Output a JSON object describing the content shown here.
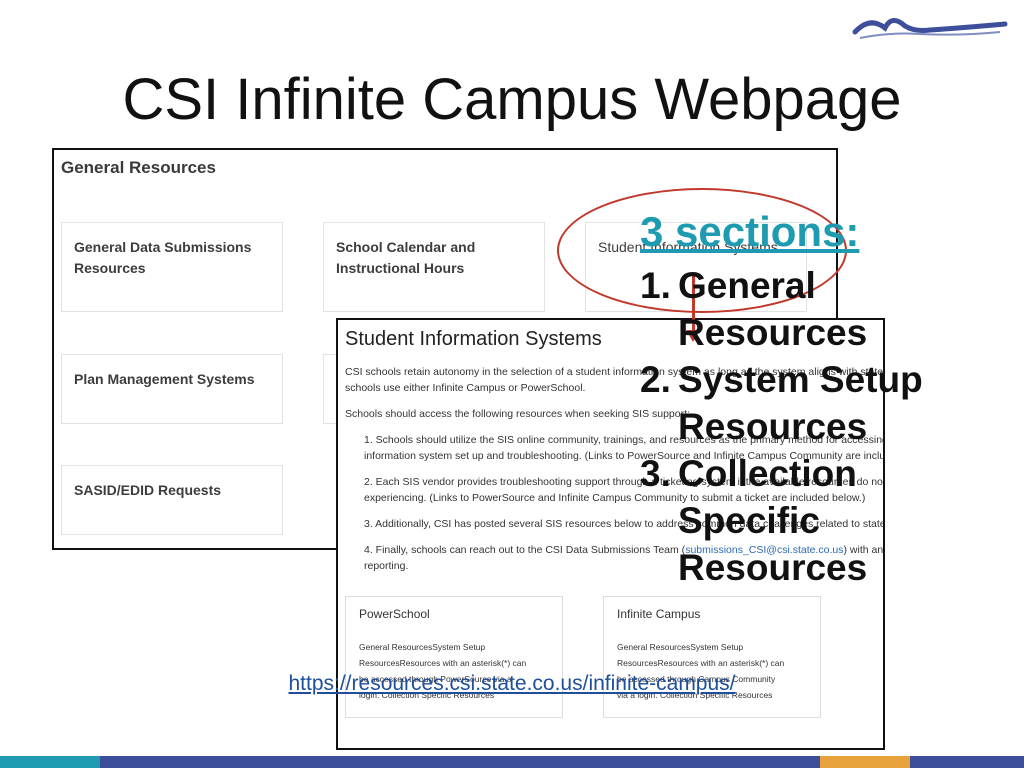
{
  "slide": {
    "title": "CSI Infinite Campus Webpage",
    "url": "https://resources.csi.state.co.us/infinite-campus/"
  },
  "screenshot_general": {
    "header": "General Resources",
    "cards": [
      "General Data Submissions Resources",
      "School Calendar and Instructional Hours",
      "Student Information Systems",
      "Plan Management Systems",
      "SASID/EDID Requests"
    ]
  },
  "screenshot_sis": {
    "header": "Student Information Systems",
    "paragraphs": [
      "CSI schools retain autonomy in the selection of a student information system as long as the system aligns with state reporting. Most",
      "schools use either Infinite Campus or PowerSchool.",
      "Schools should access the following resources when seeking SIS support:",
      "1. Schools should utilize the SIS online community, trainings, and resources as the primary method for accessing",
      "information system set up and troubleshooting. (Links to PowerSource and Infinite Campus Community are included below.)",
      "2. Each SIS vendor provides troubleshooting support through a ticketing system if the available resources do not address the issue",
      "experiencing. (Links to PowerSource and Infinite Campus Community to submit a ticket are included below.)",
      "3. Additionally, CSI has posted several SIS resources below to address common data challenges related to state reporting.",
      "4. Finally, schools can reach out to the CSI Data Submissions Team (",
      "submissions_CSI@csi.state.co.us",
      ") with any questions related to state",
      "reporting."
    ],
    "powerschool": {
      "title": "PowerSchool",
      "line1": "General ResourcesSystem Setup",
      "line2": "ResourcesResources with an asterisk(*) can",
      "line3": "be accessed through PowerSource via a",
      "line4": "login.  Collection Specific Resources"
    },
    "infinite_campus": {
      "title": "Infinite Campus",
      "line1": "General ResourcesSystem Setup",
      "line2": "ResourcesResources with an asterisk(*) can",
      "line3": "be accessed through Campus Community",
      "line4": "via a login. Collection Specific Resources"
    }
  },
  "callout": {
    "title": "3 sections:",
    "items": [
      {
        "num": "1.",
        "line1": "General",
        "line2": "Resources"
      },
      {
        "num": "2.",
        "line1": "System Setup",
        "line2": "Resources"
      },
      {
        "num": "3.",
        "line1": "Collection",
        "line2": "Specific",
        "line3": "Resources"
      }
    ]
  },
  "colors": {
    "accent_teal": "#1e9bb0",
    "highlight_red": "#c0392b",
    "link_blue": "#1f4e9c",
    "logo_blue": "#3d4f9a",
    "bar_teal": "#1e9bb0",
    "bar_blue": "#3d4f9a",
    "bar_orange": "#e8a33d"
  }
}
